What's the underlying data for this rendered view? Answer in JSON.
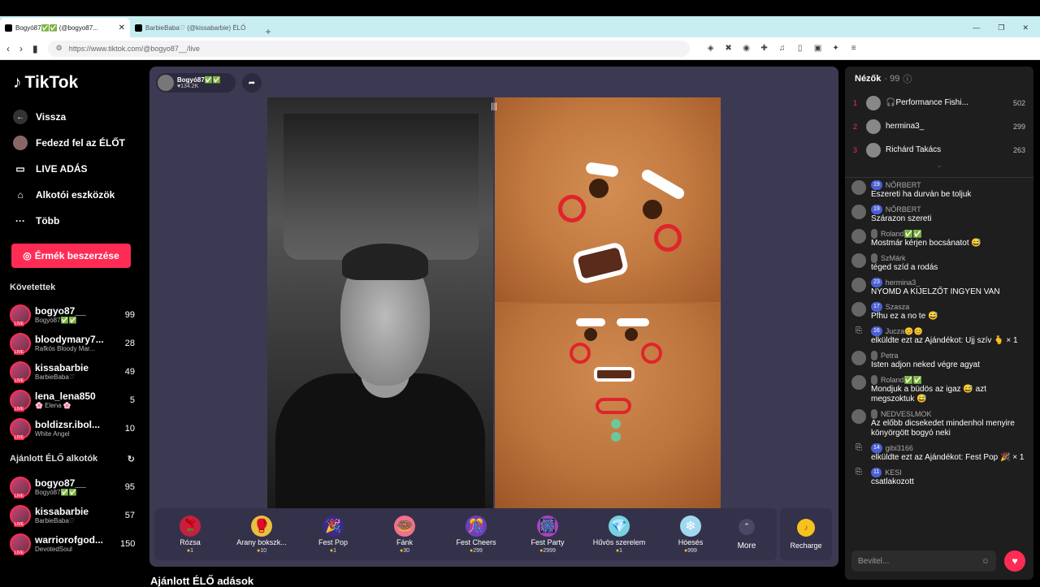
{
  "browser": {
    "tabs": [
      {
        "title": "Bogyó87✅✅ (@bogyo87..."
      },
      {
        "title": "BarbieBaba♡ (@kissabarbie) ÉLŐ"
      }
    ],
    "url": "https://www.tiktok.com/@bogyo87__/live"
  },
  "sidebar": {
    "logo": "TikTok",
    "nav": [
      {
        "label": "Vissza"
      },
      {
        "label": "Fedezd fel az ÉLŐT"
      },
      {
        "label": "LIVE ADÁS"
      },
      {
        "label": "Alkotói eszközök"
      },
      {
        "label": "Több"
      }
    ],
    "buy_button": "Érmék beszerzése",
    "following_title": "Követettek",
    "following": [
      {
        "name": "bogyo87__",
        "sub": "Bogyó87✅✅",
        "count": "99"
      },
      {
        "name": "bloodymary7...",
        "sub": "Rafkós Bloody Mar...",
        "count": "28"
      },
      {
        "name": "kissabarbie",
        "sub": "BarbieBaba♡",
        "count": "49"
      },
      {
        "name": "lena_lena850",
        "sub": "🌸 Elena 🌸",
        "count": "5"
      },
      {
        "name": "boldizsr.ibol...",
        "sub": "White Angel",
        "count": "10"
      }
    ],
    "recommended_title": "Ajánlott ÉLŐ alkotók",
    "recommended": [
      {
        "name": "bogyo87__",
        "sub": "Bogyó87✅✅",
        "count": "95"
      },
      {
        "name": "kissabarbie",
        "sub": "BarbieBaba♡",
        "count": "57"
      },
      {
        "name": "warriorofgod...",
        "sub": "DevotedSoul",
        "count": "150"
      }
    ],
    "live_badge": "LIVE"
  },
  "stream": {
    "host_name": "Bogyó87✅✅",
    "host_likes": "♥134.2K",
    "gifts": [
      {
        "name": "Rózsa",
        "price": "1",
        "icon": "🌹"
      },
      {
        "name": "Arany bokszk...",
        "price": "10",
        "icon": "🥊"
      },
      {
        "name": "Fest Pop",
        "price": "1",
        "icon": "🎉"
      },
      {
        "name": "Fánk",
        "price": "30",
        "icon": "🍩"
      },
      {
        "name": "Fest Cheers",
        "price": "299",
        "icon": "🎊"
      },
      {
        "name": "Fest Party",
        "price": "2999",
        "icon": "🎆"
      },
      {
        "name": "Hűvös szerelem",
        "price": "1",
        "icon": "💎"
      },
      {
        "name": "Hóesés",
        "price": "999",
        "icon": "❄"
      }
    ],
    "more_label": "More",
    "recharge_label": "Recharge",
    "below_title": "Ajánlott ÉLŐ adások"
  },
  "chat": {
    "viewers_title": "Nézők",
    "viewers_count": "· 99",
    "top_viewers": [
      {
        "rank": "1",
        "name": "🎧Performance Fishi...",
        "score": "502"
      },
      {
        "rank": "2",
        "name": "hermina3_",
        "score": "299"
      },
      {
        "rank": "3",
        "name": "Richárd Takács",
        "score": "263"
      }
    ],
    "messages": [
      {
        "badge": "19",
        "name": "NŐRBERT",
        "text": "Eszereti ha durván be toljuk",
        "gift": false
      },
      {
        "badge": "19",
        "name": "NŐRBERT",
        "text": "Szárazon szereti",
        "gift": false
      },
      {
        "badge": "",
        "name": "Roland✅✅",
        "text": "Mostmár kérjen bocsánatot 😅",
        "gift": false
      },
      {
        "badge": "",
        "name": "SzMárk",
        "text": "téged szíd a rodás",
        "gift": false
      },
      {
        "badge": "23",
        "name": "hermina3_",
        "text": "NYOMD A KIJELZŐT INGYEN VAN",
        "gift": false
      },
      {
        "badge": "17",
        "name": "Szasza",
        "text": "Pfhu ez a no te 😅",
        "gift": false
      },
      {
        "badge": "16",
        "name": "Jucza😊😊",
        "text": "elküldte ezt az Ajándékot: Ujj szív 🫰 × 1",
        "gift": true
      },
      {
        "badge": "",
        "name": "Petra",
        "text": "Isten adjon neked végre agyat",
        "gift": false
      },
      {
        "badge": "",
        "name": "Roland✅✅",
        "text": "Mondjuk a büdös az igaz 😅 azt megszoktuk 😅",
        "gift": false
      },
      {
        "badge": "",
        "name": "NEDVESLMOK",
        "text": "Az előbb dicsekedet mindenhol menyire könyörgött bogyó neki",
        "gift": false
      },
      {
        "badge": "14",
        "name": "gibi3166",
        "text": "elküldte ezt az Ajándékot: Fest Pop 🎉 × 1",
        "gift": true
      },
      {
        "badge": "11",
        "name": "KESI",
        "text": "csatlakozott",
        "gift": true
      }
    ],
    "input_placeholder": "Bevitel..."
  }
}
